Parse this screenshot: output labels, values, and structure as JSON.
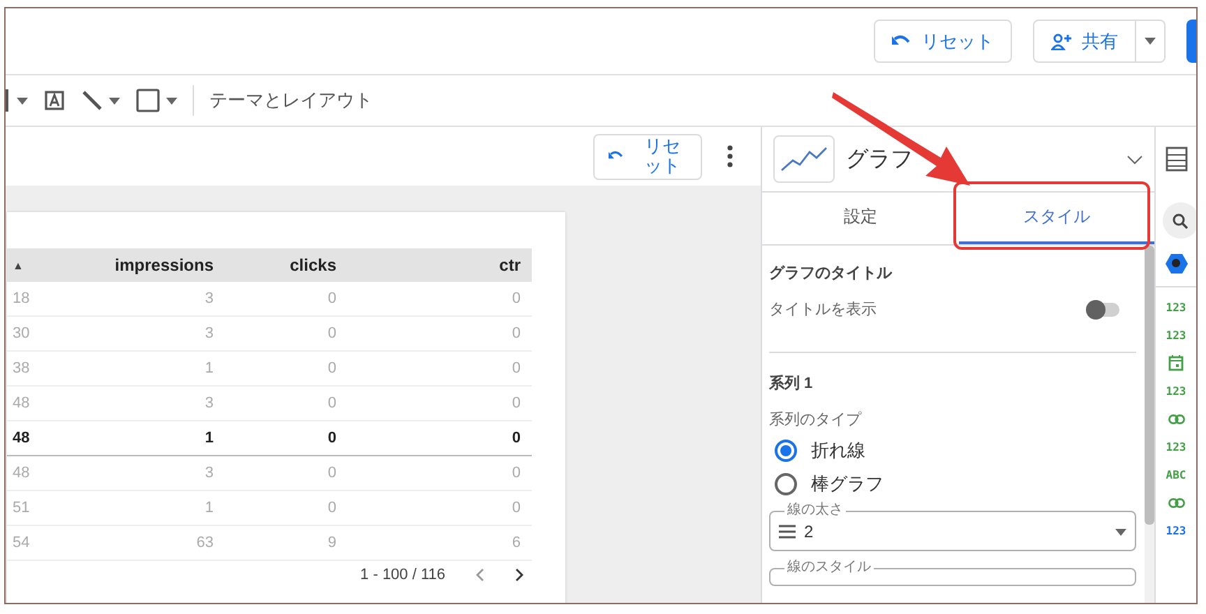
{
  "header": {
    "reset_button": "リセット",
    "share_button": "共有"
  },
  "toolbar": {
    "theme_layout": "テーマとレイアウト"
  },
  "canvas": {
    "reset_button": "リセット",
    "table": {
      "columns": [
        "▲",
        "impressions",
        "clicks",
        "ctr"
      ],
      "rows": [
        {
          "cells": [
            "18",
            "3",
            "0",
            "0"
          ],
          "highlighted": false
        },
        {
          "cells": [
            "30",
            "3",
            "0",
            "0"
          ],
          "highlighted": false
        },
        {
          "cells": [
            "38",
            "1",
            "0",
            "0"
          ],
          "highlighted": false
        },
        {
          "cells": [
            "48",
            "3",
            "0",
            "0"
          ],
          "highlighted": false
        },
        {
          "cells": [
            "48",
            "1",
            "0",
            "0"
          ],
          "highlighted": true
        },
        {
          "cells": [
            "48",
            "3",
            "0",
            "0"
          ],
          "highlighted": false
        },
        {
          "cells": [
            "51",
            "1",
            "0",
            "0"
          ],
          "highlighted": false
        },
        {
          "cells": [
            "54",
            "63",
            "9",
            "6"
          ],
          "highlighted": false
        }
      ],
      "pagination": "1 - 100 / 116"
    }
  },
  "panel": {
    "chart_type": "グラフ",
    "tabs": [
      {
        "label": "設定",
        "selected": false
      },
      {
        "label": "スタイル",
        "selected": true
      }
    ],
    "chart_title": {
      "heading": "グラフのタイトル",
      "show_title_label": "タイトルを表示",
      "show_title": false
    },
    "series": {
      "heading": "系列 1",
      "type_label": "系列のタイプ",
      "options": [
        {
          "label": "折れ線",
          "selected": true
        },
        {
          "label": "棒グラフ",
          "selected": false
        }
      ],
      "line_weight": {
        "label": "線の太さ",
        "value": "2"
      },
      "line_style": {
        "label": "線のスタイル"
      }
    }
  },
  "rail": {
    "fields": [
      {
        "kind": "number",
        "label": "123",
        "color": "#43a047"
      },
      {
        "kind": "number",
        "label": "123",
        "color": "#43a047"
      },
      {
        "kind": "date",
        "color": "#43a047"
      },
      {
        "kind": "number",
        "label": "123",
        "color": "#43a047"
      },
      {
        "kind": "link",
        "color": "#43a047"
      },
      {
        "kind": "number",
        "label": "123",
        "color": "#43a047"
      },
      {
        "kind": "text",
        "label": "ABC",
        "color": "#43a047"
      },
      {
        "kind": "link",
        "color": "#43a047"
      },
      {
        "kind": "number",
        "label": "123",
        "color": "#1a73e8"
      }
    ]
  }
}
